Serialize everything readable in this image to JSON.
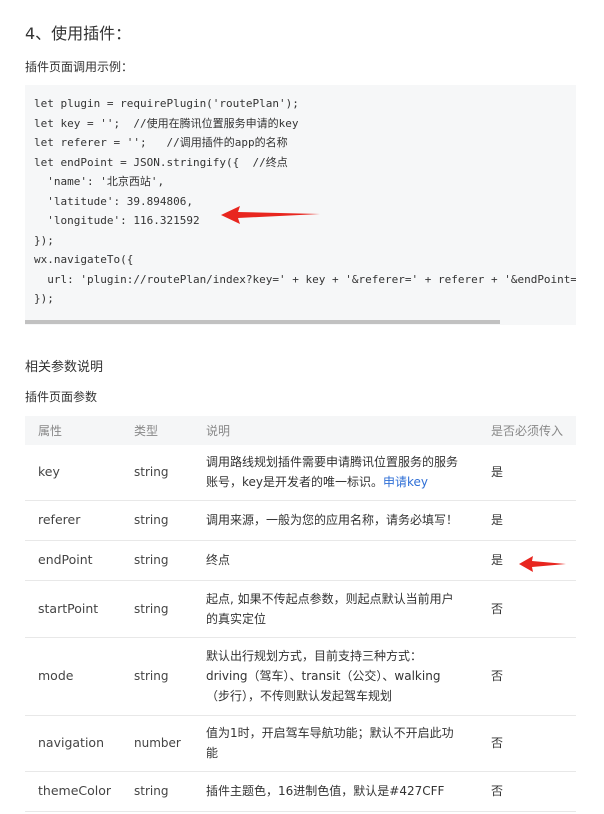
{
  "heading": "4、使用插件：",
  "subtitle": "插件页面调用示例：",
  "code_lines": [
    "let plugin = requirePlugin('routePlan');",
    "let key = '';  //使用在腾讯位置服务申请的key",
    "let referer = '';   //调用插件的app的名称",
    "let endPoint = JSON.stringify({  //终点",
    "  'name': '北京西站',",
    "  'latitude': 39.894806,",
    "  'longitude': 116.321592",
    "});",
    "wx.navigateTo({",
    "  url: 'plugin://routePlan/index?key=' + key + '&referer=' + referer + '&endPoint=' + endPoint",
    "});"
  ],
  "section_title": "相关参数说明",
  "table_caption": "插件页面参数",
  "table": {
    "headers": [
      "属性",
      "类型",
      "说明",
      "是否必须传入"
    ],
    "rows": [
      {
        "name": "key",
        "type": "string",
        "desc": "调用路线规划插件需要申请腾讯位置服务的服务账号，key是开发者的唯一标识。",
        "link": "申请key",
        "required": "是"
      },
      {
        "name": "referer",
        "type": "string",
        "desc": "调用来源，一般为您的应用名称，请务必填写！",
        "required": "是"
      },
      {
        "name": "endPoint",
        "type": "string",
        "desc": "终点",
        "required": "是"
      },
      {
        "name": "startPoint",
        "type": "string",
        "desc": "起点, 如果不传起点参数，则起点默认当前用户的真实定位",
        "required": "否"
      },
      {
        "name": "mode",
        "type": "string",
        "desc": "默认出行规划方式，目前支持三种方式：driving（驾车）、transit（公交）、walking（步行），不传则默认发起驾车规划",
        "required": "否"
      },
      {
        "name": "navigation",
        "type": "number",
        "desc": "值为1时，开启驾车导航功能；默认不开启此功能",
        "required": "否"
      },
      {
        "name": "themeColor",
        "type": "string",
        "desc": "插件主题色，16进制色值，默认是#427CFF",
        "required": "否"
      }
    ]
  },
  "colors": {
    "arrow": "#e8261f",
    "link": "#2f6fd6",
    "code_bg": "#f6f7f8",
    "header_bg": "#f5f6f7"
  }
}
